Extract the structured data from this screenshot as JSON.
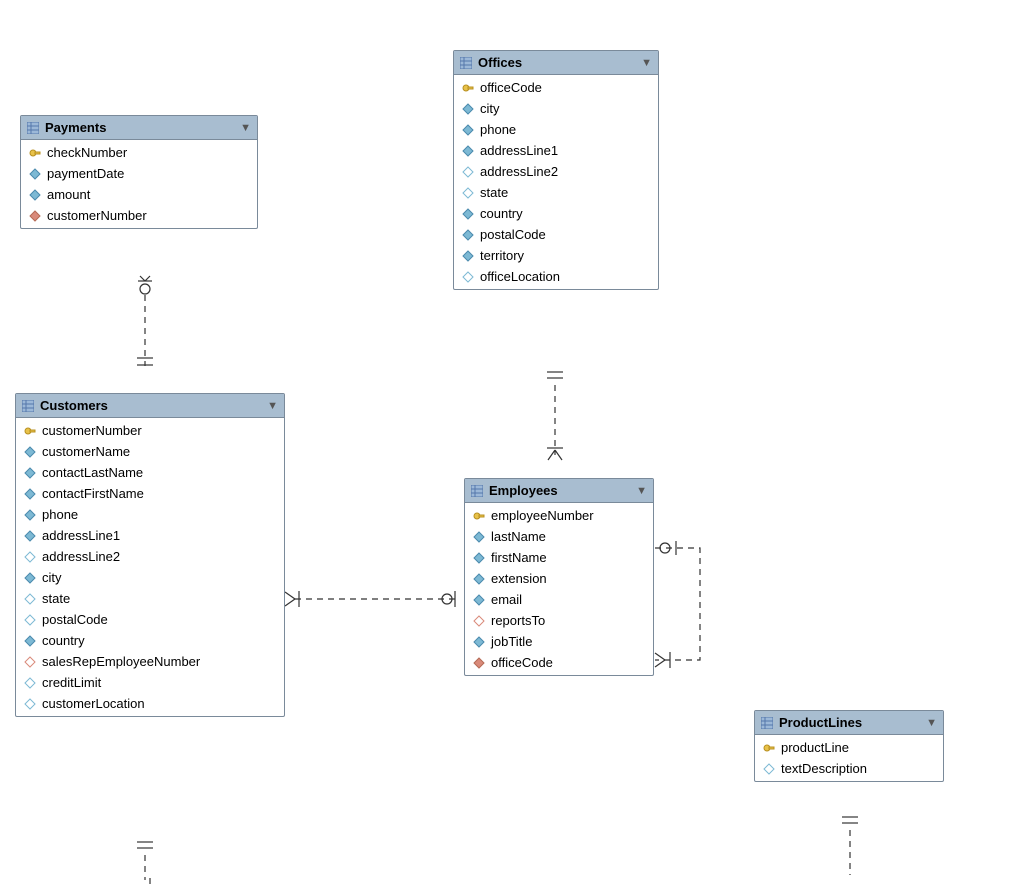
{
  "entities": {
    "payments": {
      "title": "Payments",
      "fields": [
        {
          "name": "checkNumber",
          "icon": "key"
        },
        {
          "name": "paymentDate",
          "icon": "diamond-fill"
        },
        {
          "name": "amount",
          "icon": "diamond-fill"
        },
        {
          "name": "customerNumber",
          "icon": "diamond-red"
        }
      ]
    },
    "offices": {
      "title": "Offices",
      "fields": [
        {
          "name": "officeCode",
          "icon": "key"
        },
        {
          "name": "city",
          "icon": "diamond-fill"
        },
        {
          "name": "phone",
          "icon": "diamond-fill"
        },
        {
          "name": "addressLine1",
          "icon": "diamond-fill"
        },
        {
          "name": "addressLine2",
          "icon": "diamond-outline"
        },
        {
          "name": "state",
          "icon": "diamond-outline"
        },
        {
          "name": "country",
          "icon": "diamond-fill"
        },
        {
          "name": "postalCode",
          "icon": "diamond-fill"
        },
        {
          "name": "territory",
          "icon": "diamond-fill"
        },
        {
          "name": "officeLocation",
          "icon": "diamond-outline"
        }
      ]
    },
    "customers": {
      "title": "Customers",
      "fields": [
        {
          "name": "customerNumber",
          "icon": "key"
        },
        {
          "name": "customerName",
          "icon": "diamond-fill"
        },
        {
          "name": "contactLastName",
          "icon": "diamond-fill"
        },
        {
          "name": "contactFirstName",
          "icon": "diamond-fill"
        },
        {
          "name": "phone",
          "icon": "diamond-fill"
        },
        {
          "name": "addressLine1",
          "icon": "diamond-fill"
        },
        {
          "name": "addressLine2",
          "icon": "diamond-outline"
        },
        {
          "name": "city",
          "icon": "diamond-fill"
        },
        {
          "name": "state",
          "icon": "diamond-outline"
        },
        {
          "name": "postalCode",
          "icon": "diamond-outline"
        },
        {
          "name": "country",
          "icon": "diamond-fill"
        },
        {
          "name": "salesRepEmployeeNumber",
          "icon": "diamond-red-outline"
        },
        {
          "name": "creditLimit",
          "icon": "diamond-outline"
        },
        {
          "name": "customerLocation",
          "icon": "diamond-outline"
        }
      ]
    },
    "employees": {
      "title": "Employees",
      "fields": [
        {
          "name": "employeeNumber",
          "icon": "key"
        },
        {
          "name": "lastName",
          "icon": "diamond-fill"
        },
        {
          "name": "firstName",
          "icon": "diamond-fill"
        },
        {
          "name": "extension",
          "icon": "diamond-fill"
        },
        {
          "name": "email",
          "icon": "diamond-fill"
        },
        {
          "name": "reportsTo",
          "icon": "diamond-red-outline"
        },
        {
          "name": "jobTitle",
          "icon": "diamond-fill"
        },
        {
          "name": "officeCode",
          "icon": "diamond-red"
        }
      ]
    },
    "productlines": {
      "title": "ProductLines",
      "fields": [
        {
          "name": "productLine",
          "icon": "key"
        },
        {
          "name": "textDescription",
          "icon": "diamond-outline"
        }
      ]
    }
  },
  "relationships": [
    {
      "from": "Payments",
      "to": "Customers",
      "kind": "many-to-one"
    },
    {
      "from": "Customers",
      "to": "Employees",
      "kind": "many-to-one-optional"
    },
    {
      "from": "Employees",
      "to": "Offices",
      "kind": "many-to-one"
    },
    {
      "from": "Employees",
      "to": "Employees",
      "kind": "self-many-to-one-optional"
    },
    {
      "from": "Customers",
      "to": "(below)",
      "kind": "one-to-many-partial"
    },
    {
      "from": "ProductLines",
      "to": "(below)",
      "kind": "one-to-many-partial"
    }
  ]
}
